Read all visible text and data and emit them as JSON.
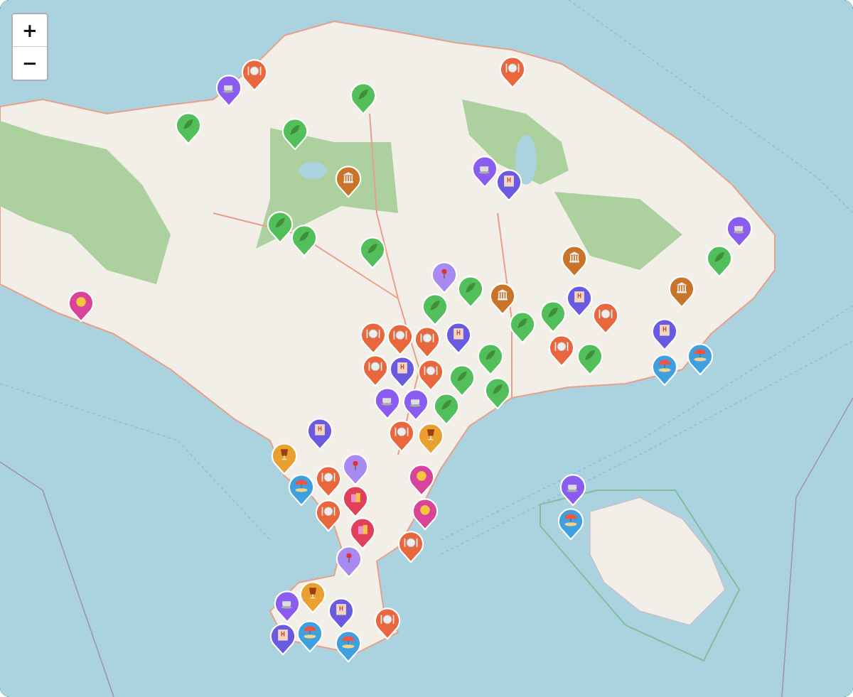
{
  "zoom_controls": {
    "zoom_in": "+",
    "zoom_out": "−"
  },
  "pins": [
    {
      "kind": "food",
      "color": "#e8673c"
    },
    {
      "kind": "cafe",
      "color": "#8b5cf0"
    },
    {
      "kind": "nature",
      "color": "#52bf5a"
    },
    {
      "kind": "nature",
      "color": "#52bf5a"
    },
    {
      "kind": "nature",
      "color": "#52bf5a"
    },
    {
      "kind": "food",
      "color": "#e8673c"
    },
    {
      "kind": "temple",
      "color": "#c8752a"
    },
    {
      "kind": "cafe",
      "color": "#8b5cf0"
    },
    {
      "kind": "hotel",
      "color": "#6a5ae0"
    },
    {
      "kind": "nature",
      "color": "#52bf5a"
    },
    {
      "kind": "nature",
      "color": "#52bf5a"
    },
    {
      "kind": "nature",
      "color": "#52bf5a"
    },
    {
      "kind": "temple",
      "color": "#c8752a"
    },
    {
      "kind": "cafe",
      "color": "#8b5cf0"
    },
    {
      "kind": "nature",
      "color": "#52bf5a"
    },
    {
      "kind": "temple",
      "color": "#c8752a"
    },
    {
      "kind": "spa",
      "color": "#d9449a"
    },
    {
      "kind": "place",
      "color": "#a98af0"
    },
    {
      "kind": "nature",
      "color": "#52bf5a"
    },
    {
      "kind": "nature",
      "color": "#52bf5a"
    },
    {
      "kind": "temple",
      "color": "#c8752a"
    },
    {
      "kind": "nature",
      "color": "#52bf5a"
    },
    {
      "kind": "hotel",
      "color": "#6a5ae0"
    },
    {
      "kind": "food",
      "color": "#e8673c"
    },
    {
      "kind": "nature",
      "color": "#52bf5a"
    },
    {
      "kind": "food",
      "color": "#e8673c"
    },
    {
      "kind": "nature",
      "color": "#52bf5a"
    },
    {
      "kind": "hotel",
      "color": "#6a5ae0"
    },
    {
      "kind": "beach",
      "color": "#3fa0e0"
    },
    {
      "kind": "beach",
      "color": "#3fa0e0"
    },
    {
      "kind": "food",
      "color": "#e8673c"
    },
    {
      "kind": "food",
      "color": "#e8673c"
    },
    {
      "kind": "food",
      "color": "#e8673c"
    },
    {
      "kind": "hotel",
      "color": "#6a5ae0"
    },
    {
      "kind": "nature",
      "color": "#52bf5a"
    },
    {
      "kind": "nature",
      "color": "#52bf5a"
    },
    {
      "kind": "nature",
      "color": "#52bf5a"
    },
    {
      "kind": "food",
      "color": "#e8673c"
    },
    {
      "kind": "hotel",
      "color": "#6a5ae0"
    },
    {
      "kind": "food",
      "color": "#e8673c"
    },
    {
      "kind": "cafe",
      "color": "#8b5cf0"
    },
    {
      "kind": "cafe",
      "color": "#8b5cf0"
    },
    {
      "kind": "food",
      "color": "#e8673c"
    },
    {
      "kind": "nature",
      "color": "#52bf5a"
    },
    {
      "kind": "bar",
      "color": "#eaa030"
    },
    {
      "kind": "hotel",
      "color": "#6a5ae0"
    },
    {
      "kind": "bar",
      "color": "#eaa030"
    },
    {
      "kind": "beach",
      "color": "#3fa0e0"
    },
    {
      "kind": "food",
      "color": "#e8673c"
    },
    {
      "kind": "place",
      "color": "#a98af0"
    },
    {
      "kind": "shop",
      "color": "#e0405a"
    },
    {
      "kind": "food",
      "color": "#e8673c"
    },
    {
      "kind": "shop",
      "color": "#e0405a"
    },
    {
      "kind": "spa",
      "color": "#d9449a"
    },
    {
      "kind": "spa",
      "color": "#d9449a"
    },
    {
      "kind": "food",
      "color": "#e8673c"
    },
    {
      "kind": "place",
      "color": "#a98af0"
    },
    {
      "kind": "cafe",
      "color": "#8b5cf0"
    },
    {
      "kind": "beach",
      "color": "#3fa0e0"
    },
    {
      "kind": "bar",
      "color": "#eaa030"
    },
    {
      "kind": "cafe",
      "color": "#8b5cf0"
    },
    {
      "kind": "hotel",
      "color": "#6a5ae0"
    },
    {
      "kind": "beach",
      "color": "#3fa0e0"
    },
    {
      "kind": "hotel",
      "color": "#6a5ae0"
    },
    {
      "kind": "beach",
      "color": "#3fa0e0"
    },
    {
      "kind": "food",
      "color": "#e8673c"
    }
  ]
}
